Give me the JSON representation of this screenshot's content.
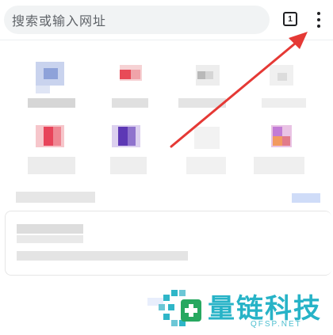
{
  "omnibox": {
    "placeholder": "搜索或输入网址"
  },
  "toolbar": {
    "tab_count": "1",
    "menu_icon": "vertical-dots-icon"
  },
  "annotation": {
    "arrow_color": "#e53935"
  },
  "watermark": {
    "brand": "量链科技",
    "domain": "QFSP.NET",
    "color": "#27b3c7"
  }
}
